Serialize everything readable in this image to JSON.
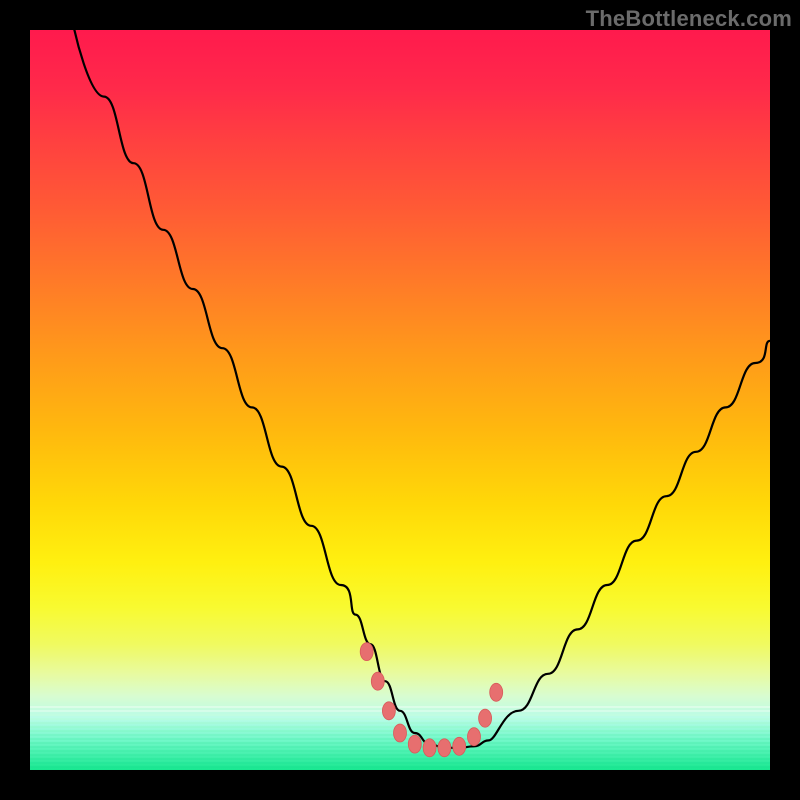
{
  "watermark": "TheBottleneck.com",
  "colors": {
    "gradient_top": "#ff1a4d",
    "gradient_mid": "#ffd808",
    "gradient_bottom": "#18e890",
    "curve": "#000000",
    "marker_fill": "#e76f6f",
    "marker_stroke": "#d85a5a",
    "frame": "#000000"
  },
  "chart_data": {
    "type": "line",
    "title": "",
    "xlabel": "",
    "ylabel": "",
    "xlim": [
      0,
      100
    ],
    "ylim": [
      0,
      100
    ],
    "grid": false,
    "legend": false,
    "series": [
      {
        "name": "bottleneck-curve",
        "x": [
          6,
          10,
          14,
          18,
          22,
          26,
          30,
          34,
          38,
          42,
          44,
          46,
          48,
          50,
          52,
          54,
          56,
          58,
          60,
          62,
          66,
          70,
          74,
          78,
          82,
          86,
          90,
          94,
          98,
          100
        ],
        "y": [
          100,
          91,
          82,
          73,
          65,
          57,
          49,
          41,
          33,
          25,
          21,
          17,
          12,
          8,
          5,
          3.5,
          3,
          3,
          3.2,
          4,
          8,
          13,
          19,
          25,
          31,
          37,
          43,
          49,
          55,
          58
        ]
      }
    ],
    "markers": {
      "name": "highlight-points",
      "x": [
        45.5,
        47.0,
        48.5,
        50.0,
        52.0,
        54.0,
        56.0,
        58.0,
        60.0,
        61.5,
        63.0
      ],
      "y": [
        16.0,
        12.0,
        8.0,
        5.0,
        3.5,
        3.0,
        3.0,
        3.2,
        4.5,
        7.0,
        10.5
      ]
    }
  }
}
